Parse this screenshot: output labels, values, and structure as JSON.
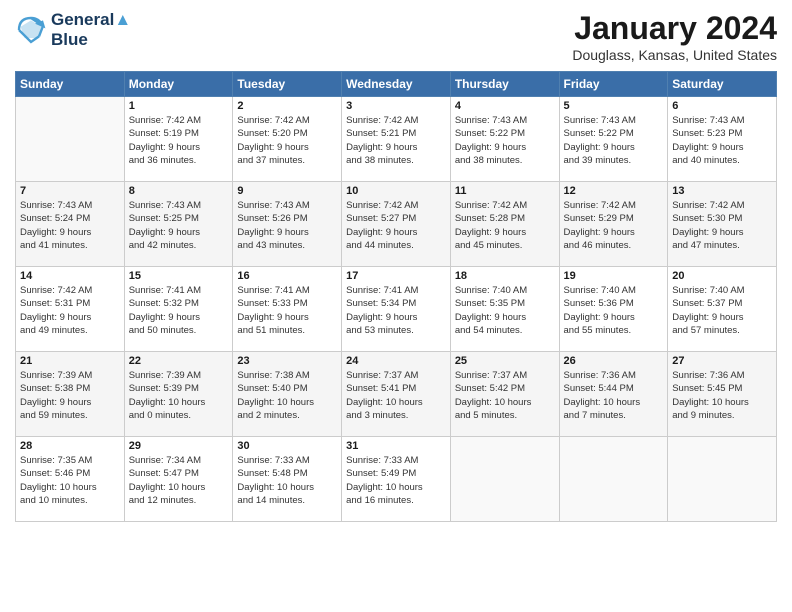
{
  "header": {
    "logo_line1": "General",
    "logo_line2": "Blue",
    "month_title": "January 2024",
    "location": "Douglass, Kansas, United States"
  },
  "weekdays": [
    "Sunday",
    "Monday",
    "Tuesday",
    "Wednesday",
    "Thursday",
    "Friday",
    "Saturday"
  ],
  "weeks": [
    [
      {
        "day": "",
        "info": ""
      },
      {
        "day": "1",
        "info": "Sunrise: 7:42 AM\nSunset: 5:19 PM\nDaylight: 9 hours\nand 36 minutes."
      },
      {
        "day": "2",
        "info": "Sunrise: 7:42 AM\nSunset: 5:20 PM\nDaylight: 9 hours\nand 37 minutes."
      },
      {
        "day": "3",
        "info": "Sunrise: 7:42 AM\nSunset: 5:21 PM\nDaylight: 9 hours\nand 38 minutes."
      },
      {
        "day": "4",
        "info": "Sunrise: 7:43 AM\nSunset: 5:22 PM\nDaylight: 9 hours\nand 38 minutes."
      },
      {
        "day": "5",
        "info": "Sunrise: 7:43 AM\nSunset: 5:22 PM\nDaylight: 9 hours\nand 39 minutes."
      },
      {
        "day": "6",
        "info": "Sunrise: 7:43 AM\nSunset: 5:23 PM\nDaylight: 9 hours\nand 40 minutes."
      }
    ],
    [
      {
        "day": "7",
        "info": "Sunrise: 7:43 AM\nSunset: 5:24 PM\nDaylight: 9 hours\nand 41 minutes."
      },
      {
        "day": "8",
        "info": "Sunrise: 7:43 AM\nSunset: 5:25 PM\nDaylight: 9 hours\nand 42 minutes."
      },
      {
        "day": "9",
        "info": "Sunrise: 7:43 AM\nSunset: 5:26 PM\nDaylight: 9 hours\nand 43 minutes."
      },
      {
        "day": "10",
        "info": "Sunrise: 7:42 AM\nSunset: 5:27 PM\nDaylight: 9 hours\nand 44 minutes."
      },
      {
        "day": "11",
        "info": "Sunrise: 7:42 AM\nSunset: 5:28 PM\nDaylight: 9 hours\nand 45 minutes."
      },
      {
        "day": "12",
        "info": "Sunrise: 7:42 AM\nSunset: 5:29 PM\nDaylight: 9 hours\nand 46 minutes."
      },
      {
        "day": "13",
        "info": "Sunrise: 7:42 AM\nSunset: 5:30 PM\nDaylight: 9 hours\nand 47 minutes."
      }
    ],
    [
      {
        "day": "14",
        "info": "Sunrise: 7:42 AM\nSunset: 5:31 PM\nDaylight: 9 hours\nand 49 minutes."
      },
      {
        "day": "15",
        "info": "Sunrise: 7:41 AM\nSunset: 5:32 PM\nDaylight: 9 hours\nand 50 minutes."
      },
      {
        "day": "16",
        "info": "Sunrise: 7:41 AM\nSunset: 5:33 PM\nDaylight: 9 hours\nand 51 minutes."
      },
      {
        "day": "17",
        "info": "Sunrise: 7:41 AM\nSunset: 5:34 PM\nDaylight: 9 hours\nand 53 minutes."
      },
      {
        "day": "18",
        "info": "Sunrise: 7:40 AM\nSunset: 5:35 PM\nDaylight: 9 hours\nand 54 minutes."
      },
      {
        "day": "19",
        "info": "Sunrise: 7:40 AM\nSunset: 5:36 PM\nDaylight: 9 hours\nand 55 minutes."
      },
      {
        "day": "20",
        "info": "Sunrise: 7:40 AM\nSunset: 5:37 PM\nDaylight: 9 hours\nand 57 minutes."
      }
    ],
    [
      {
        "day": "21",
        "info": "Sunrise: 7:39 AM\nSunset: 5:38 PM\nDaylight: 9 hours\nand 59 minutes."
      },
      {
        "day": "22",
        "info": "Sunrise: 7:39 AM\nSunset: 5:39 PM\nDaylight: 10 hours\nand 0 minutes."
      },
      {
        "day": "23",
        "info": "Sunrise: 7:38 AM\nSunset: 5:40 PM\nDaylight: 10 hours\nand 2 minutes."
      },
      {
        "day": "24",
        "info": "Sunrise: 7:37 AM\nSunset: 5:41 PM\nDaylight: 10 hours\nand 3 minutes."
      },
      {
        "day": "25",
        "info": "Sunrise: 7:37 AM\nSunset: 5:42 PM\nDaylight: 10 hours\nand 5 minutes."
      },
      {
        "day": "26",
        "info": "Sunrise: 7:36 AM\nSunset: 5:44 PM\nDaylight: 10 hours\nand 7 minutes."
      },
      {
        "day": "27",
        "info": "Sunrise: 7:36 AM\nSunset: 5:45 PM\nDaylight: 10 hours\nand 9 minutes."
      }
    ],
    [
      {
        "day": "28",
        "info": "Sunrise: 7:35 AM\nSunset: 5:46 PM\nDaylight: 10 hours\nand 10 minutes."
      },
      {
        "day": "29",
        "info": "Sunrise: 7:34 AM\nSunset: 5:47 PM\nDaylight: 10 hours\nand 12 minutes."
      },
      {
        "day": "30",
        "info": "Sunrise: 7:33 AM\nSunset: 5:48 PM\nDaylight: 10 hours\nand 14 minutes."
      },
      {
        "day": "31",
        "info": "Sunrise: 7:33 AM\nSunset: 5:49 PM\nDaylight: 10 hours\nand 16 minutes."
      },
      {
        "day": "",
        "info": ""
      },
      {
        "day": "",
        "info": ""
      },
      {
        "day": "",
        "info": ""
      }
    ]
  ]
}
